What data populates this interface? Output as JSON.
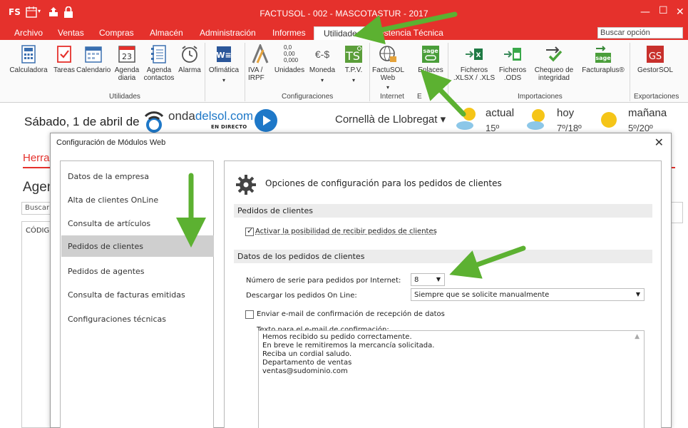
{
  "titlebar": {
    "logo": "FS",
    "title": "FACTUSOL - 002 - MASCOTASTUR - 2017",
    "quick_icons": [
      "calendar-icon",
      "upload-icon",
      "lock-icon"
    ],
    "minimize": "—",
    "maximize": "☐",
    "close": "✕",
    "accent": "#e5312c"
  },
  "menu": {
    "tabs": [
      "Archivo",
      "Ventas",
      "Compras",
      "Almacén",
      "Administración",
      "Informes",
      "Utilidades",
      "Asistencia Técnica"
    ],
    "active_tab": "Utilidades",
    "search_placeholder": "Buscar opción"
  },
  "ribbon": {
    "buttons": [
      {
        "label": "Calculadora",
        "icon": "calculator-icon"
      },
      {
        "label": "Tareas",
        "icon": "tasks-icon"
      },
      {
        "label": "Calendario",
        "icon": "calendar-icon"
      },
      {
        "label": "Agenda diaria",
        "icon": "daily-agenda-icon"
      },
      {
        "label": "Agenda contactos",
        "icon": "contacts-agenda-icon"
      },
      {
        "label": "Alarma",
        "icon": "alarm-icon"
      },
      {
        "label": "Ofimática",
        "icon": "word-icon"
      },
      {
        "label": "IVA / IRPF",
        "icon": "tax-icon"
      },
      {
        "label": "Unidades",
        "icon": "units-icon"
      },
      {
        "label": "Moneda",
        "icon": "currency-icon"
      },
      {
        "label": "T.P.V.",
        "icon": "tpv-icon"
      },
      {
        "label": "FactuSOL Web",
        "icon": "globe-lock-icon"
      },
      {
        "label": "Enlaces",
        "icon": "sage-link-icon"
      },
      {
        "label": "Ficheros .XLSX / .XLS",
        "icon": "excel-import-icon"
      },
      {
        "label": "Ficheros .ODS",
        "icon": "ods-import-icon"
      },
      {
        "label": "Chequeo de integridad",
        "icon": "check-icon"
      },
      {
        "label": "Facturaplus®",
        "icon": "sage-icon"
      },
      {
        "label": "GestorSOL",
        "icon": "gestorsol-icon"
      }
    ],
    "groups": [
      "Utilidades",
      "Configuraciones",
      "Internet",
      "Importaciones",
      "Exportaciones"
    ],
    "enlaces_sub": "E",
    "ticks": {
      "unidades_1": "0,0",
      "unidades_2": "0,00",
      "unidades_3": "0,000",
      "moneda": "€-$",
      "agenda_num": "23"
    }
  },
  "infobar": {
    "date": "Sábado, 1 de abril de",
    "radio_name_a": "onda",
    "radio_name_b": "delsol",
    "radio_name_c": ".com",
    "radio_live": "EN DIRECTO",
    "city": "Cornellà de Llobregat ▾",
    "weather": [
      {
        "label": "actual",
        "temp": "15º"
      },
      {
        "label": "hoy",
        "temp": "7º/18º"
      },
      {
        "label": "mañana",
        "temp": "5º/20º"
      }
    ]
  },
  "background": {
    "tab": "Herra",
    "heading": "Agen",
    "search": "Buscar",
    "column": "CÓDIG"
  },
  "dialog": {
    "title": "Configuración de Módulos Web",
    "close": "✕",
    "nav": [
      "Datos de la empresa",
      "Alta de clientes OnLine",
      "Consulta de artículos",
      "Pedidos de clientes",
      "Pedidos de agentes",
      "Consulta de facturas emitidas",
      "Configuraciones técnicas"
    ],
    "selected_nav": "Pedidos de clientes",
    "content_title": "Opciones de configuración para los pedidos de clientes",
    "section1": "Pedidos de clientes",
    "check_activate": {
      "label": "Activar la posibilidad de recibir pedidos de clientes",
      "checked": true
    },
    "section2": "Datos de los pedidos de clientes",
    "serie_label": "Número de serie para pedidos por Internet:",
    "serie_value": "8",
    "download_label": "Descargar los pedidos On Line:",
    "download_value": "Siempre que se solicite manualmente",
    "check_email": {
      "label": "Enviar e-mail de confirmación de recepción de datos",
      "checked": false
    },
    "email_text_label": "Texto para el e-mail de confirmación:",
    "email_text": [
      "Hemos recibido su pedido correctamente.",
      "En breve le remitiremos la mercancía solicitada.",
      "Reciba un cordial saludo.",
      "Departamento de ventas",
      "ventas@sudominio.com"
    ]
  },
  "annotation_color": "#5cb131"
}
